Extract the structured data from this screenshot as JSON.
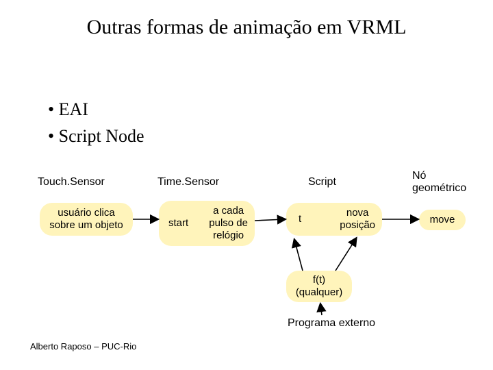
{
  "title": "Outras formas de animação em\nVRML",
  "bullets": [
    "EAI",
    "Script Node"
  ],
  "labels": {
    "touch_sensor": "Touch.Sensor",
    "time_sensor": "Time.Sensor",
    "script": "Script",
    "geom_node": "Nó\ngeométrico"
  },
  "nodes": {
    "user_click": "usuário clica\nsobre um objeto",
    "start": "start",
    "clock": "a cada\npulso de\nrelógio",
    "t": "t",
    "new_pos": "nova\nposição",
    "move": "move",
    "ft": "f(t)\n(qualquer)"
  },
  "captions": {
    "external_program": "Programa externo"
  },
  "footer": "Alberto Raposo – PUC-Rio"
}
